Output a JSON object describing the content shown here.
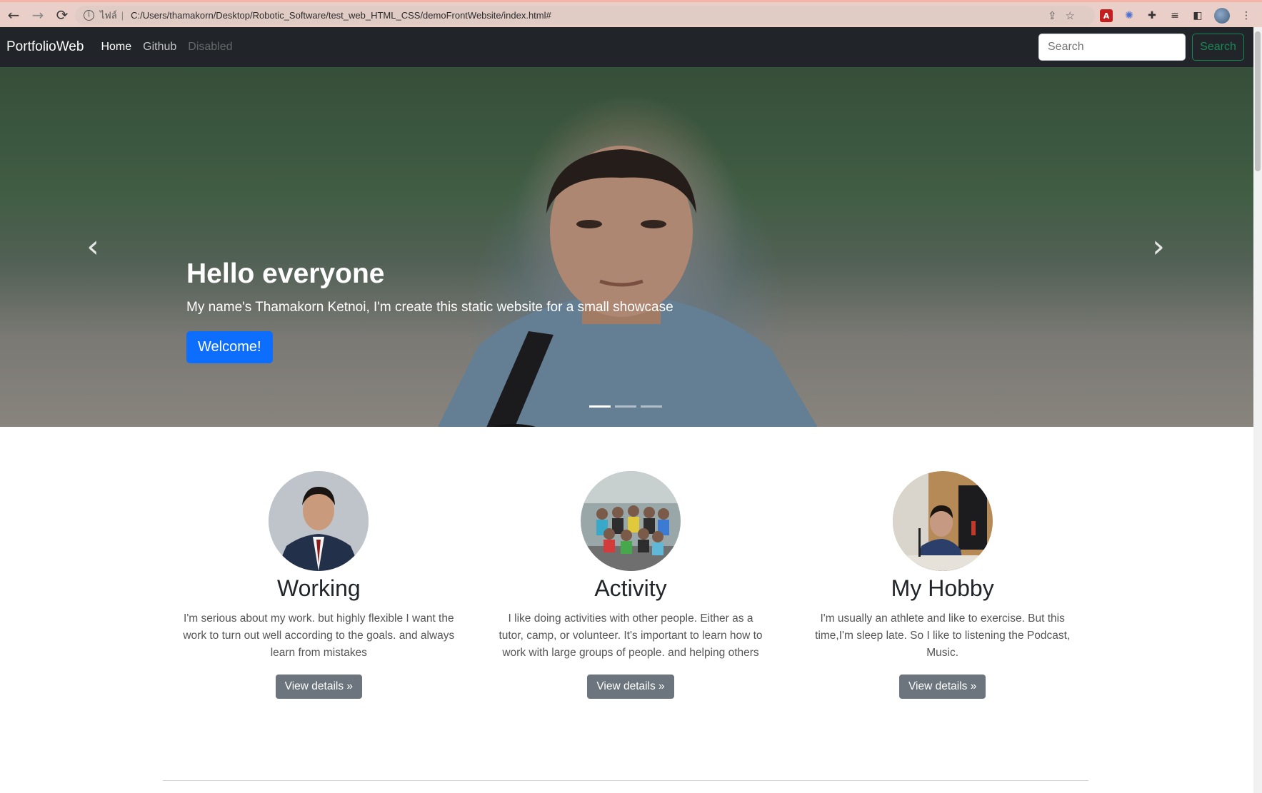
{
  "browser": {
    "scheme": "ไฟล์",
    "url": "C:/Users/thamakorn/Desktop/Robotic_Software/test_web_HTML_CSS/demoFrontWebsite/index.html#"
  },
  "navbar": {
    "brand": "PortfolioWeb",
    "links": [
      {
        "label": "Home",
        "state": "active"
      },
      {
        "label": "Github",
        "state": "normal"
      },
      {
        "label": "Disabled",
        "state": "disabled"
      }
    ],
    "search_placeholder": "Search",
    "search_button": "Search",
    "search_button_color": "#198754"
  },
  "carousel": {
    "title": "Hello everyone",
    "subtitle": "My name's Thamakorn Ketnoi, I'm create this static website for a small showcase",
    "button": "Welcome!",
    "button_color": "#0d6efd",
    "slide_count": 3,
    "active_slide": 1
  },
  "features": [
    {
      "heading": "Working",
      "text": "I'm serious about my work. but highly flexible I want the work to turn out well according to the goals. and always learn from mistakes",
      "button": "View details »"
    },
    {
      "heading": "Activity",
      "text": "I like doing activities with other people. Either as a tutor, camp, or volunteer. It's important to learn how to work with large groups of people. and helping others",
      "button": "View details »"
    },
    {
      "heading": "My Hobby",
      "text": "I'm usually an athlete and like to exercise. But this time,I'm sleep late. So I like to listening the Podcast, Music.",
      "button": "View details »"
    }
  ]
}
